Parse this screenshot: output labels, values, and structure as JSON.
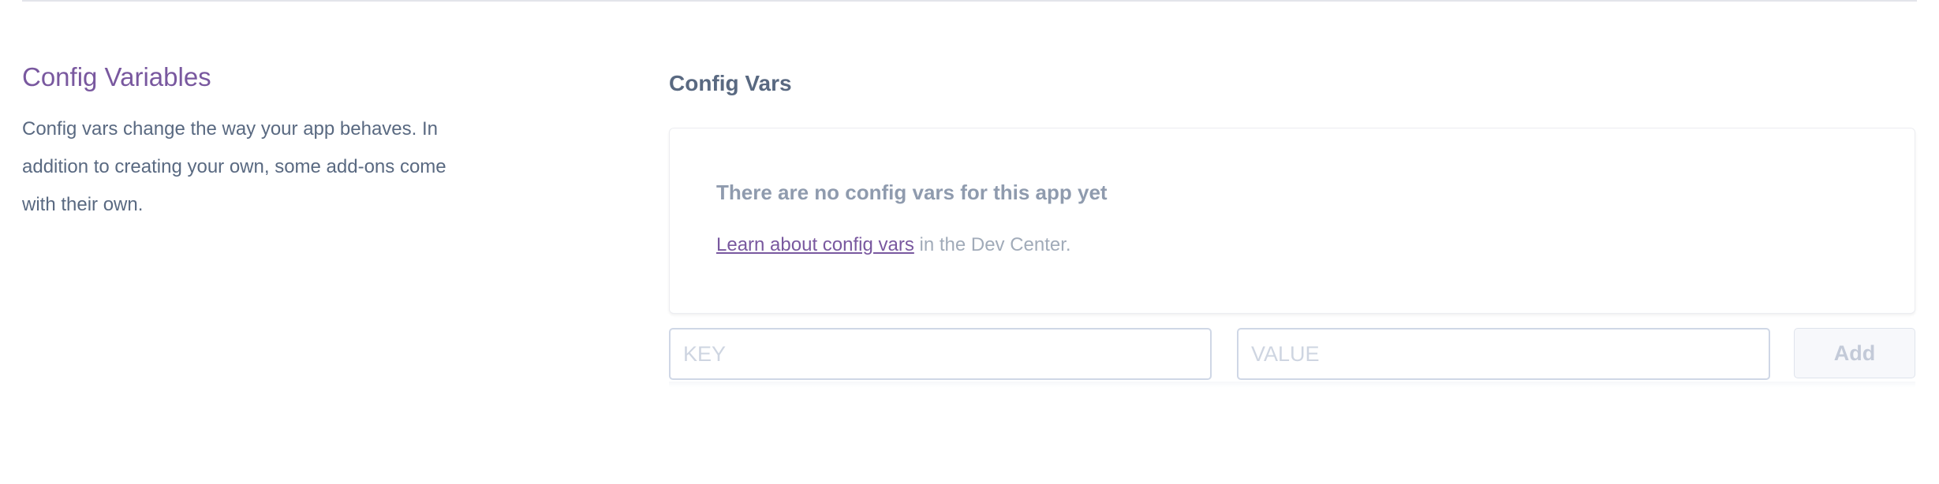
{
  "section": {
    "title": "Config Variables",
    "description": "Config vars change the way your app behaves. In addition to creating your own, some add-ons come with their own."
  },
  "config_vars": {
    "title": "Config Vars",
    "empty_heading": "There are no config vars for this app yet",
    "learn_link": "Learn about config vars",
    "learn_suffix": " in the Dev Center."
  },
  "form": {
    "key_placeholder": "KEY",
    "value_placeholder": "VALUE",
    "add_label": "Add"
  },
  "colors": {
    "accent": "#79589f",
    "text_muted": "#596981",
    "border": "#cfd7e6"
  }
}
